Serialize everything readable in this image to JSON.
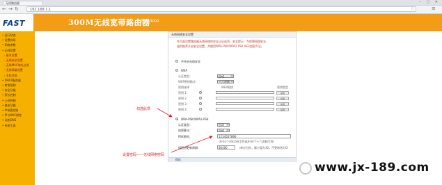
{
  "browser": {
    "tab_title": "无线路由器",
    "url": "192.168.1.1",
    "window_buttons": "– ▢ ✕"
  },
  "header": {
    "logo": "FAST",
    "title": "300M无线宽带路由器",
    "model": "型号 FW300R"
  },
  "sidebar": {
    "items": [
      {
        "label": "• 运行状态",
        "sub": false,
        "active": false
      },
      {
        "label": "• 设置向导",
        "sub": false,
        "active": false
      },
      {
        "label": "• 网络参数",
        "sub": false,
        "active": false
      },
      {
        "label": "• 无线设置",
        "sub": false,
        "active": false
      },
      {
        "label": "- 基本设置",
        "sub": true,
        "active": false
      },
      {
        "label": "- 无线安全设置",
        "sub": true,
        "active": true
      },
      {
        "label": "- 无线MAC地址过滤",
        "sub": true,
        "active": false
      },
      {
        "label": "- 无线高级设置",
        "sub": true,
        "active": false
      },
      {
        "label": "- 主机状态",
        "sub": true,
        "active": false
      },
      {
        "label": "• DHCP服务器",
        "sub": false,
        "active": false
      },
      {
        "label": "• 转发规则",
        "sub": false,
        "active": false
      },
      {
        "label": "• 安全功能",
        "sub": false,
        "active": false
      },
      {
        "label": "• 家长控制",
        "sub": false,
        "active": false
      },
      {
        "label": "• 上网控制",
        "sub": false,
        "active": false
      },
      {
        "label": "• 路由功能",
        "sub": false,
        "active": false
      },
      {
        "label": "• IP带宽控制",
        "sub": false,
        "active": false
      },
      {
        "label": "• IP与MAC绑定",
        "sub": false,
        "active": false
      },
      {
        "label": "• 动态DNS",
        "sub": false,
        "active": false
      },
      {
        "label": "• 系统工具",
        "sub": false,
        "active": false
      }
    ]
  },
  "panel": {
    "title": "无线网络安全设置",
    "notice_1": "本页面设置路由器无线网络的安全认证选项，安全提示：为保障网络安全，",
    "notice_2": "强烈推荐开启安全设置，并使用WPA-PSK/WPA2-PSK AES加密方法。",
    "notice_3": "",
    "option_off": "不开启无线安全",
    "option_wep": "WEP",
    "auth_type_label": "认证类型：",
    "auth_type_value": "自动",
    "wep_format_label": "WEP密钥格式：",
    "wep_format_value": "十六进制",
    "key_select_label": "密钥选择",
    "wep_key_label": "WEP密钥",
    "key_type_label": "密钥类型",
    "keys": [
      "密钥 1：",
      "密钥 2：",
      "密钥 3：",
      "密钥 4："
    ],
    "key_type_value": "禁用",
    "option_wpa_psk": "WPA-PSK/WPA2-PSK",
    "psk_auth_label": "认证类型：",
    "psk_auth_value": "自动",
    "psk_enc_label": "加密算法：",
    "psk_enc_value": "自动",
    "psk_pwd_label": "PSK密码：",
    "psk_pwd_value": "1234567890",
    "psk_hint": "（8-63个ASCII码字符或8-64个十六进制字符）",
    "group_key_label": "组密钥更新周期：",
    "group_key_value": "86400",
    "group_key_hint": "（单位为秒，最小值为30，不更新则为0）",
    "save_button": "保存"
  },
  "annotations": {
    "select_hint": "勾选此项",
    "password_hint": "设置密码——无线网络密码"
  },
  "watermark": {
    "text": "www.jx-189.com"
  },
  "colors": {
    "header_orange": "#f39c16",
    "sidebar_yellow": "#f5b000",
    "annotation_red": "#d6202e",
    "logo_blue": "#0b3f8a"
  }
}
